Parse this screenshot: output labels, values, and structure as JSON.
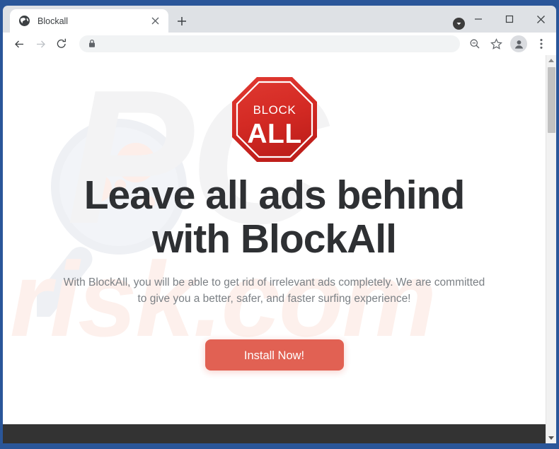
{
  "browser": {
    "frame_color": "#2a5699",
    "tab": {
      "title": "Blockall",
      "favicon_name": "globe-icon",
      "close_label": "×"
    },
    "new_tab_label": "+",
    "window_controls": {
      "minimize_label": "─",
      "maximize_label": "☐",
      "close_label": "×",
      "update_indicator_name": "update-chevron-icon"
    },
    "toolbar": {
      "back_label": "←",
      "forward_label": "→",
      "reload_label": "⟳",
      "omnibox_value": "",
      "omnibox_placeholder": "",
      "lock_icon_name": "lock-icon",
      "zoom_out_icon_name": "search-minus-icon",
      "bookmark_icon_name": "star-icon",
      "profile_icon_name": "person-icon",
      "menu_icon_name": "three-dot-menu-icon"
    }
  },
  "page": {
    "logo": {
      "top_text": "BLOCK",
      "main_text": "ALL",
      "shape": "octagon",
      "color": "#d32b25"
    },
    "headline_line1": "Leave all ads behind",
    "headline_line2": "with BlockAll",
    "headline_color": "#2e3033",
    "subheadline": "With BlockAll, you will be able to get rid of irrelevant ads completely. We are committed to give you a better, safer, and faster surfing experience!",
    "subheadline_color": "#7b8085",
    "cta_label": "Install Now!",
    "cta_color": "#e0594a",
    "footer_color": "#333333",
    "watermark": {
      "text_primary": "PC",
      "text_secondary": "risk.com",
      "primary_color": "#f3f3f4",
      "secondary_color": "#fdf0ec",
      "magnifier_icon_name": "magnifier-germs-icon"
    }
  },
  "scrollbar": {
    "up_arrow_name": "scroll-up-arrow",
    "down_arrow_name": "scroll-down-arrow",
    "thumb_name": "scroll-thumb"
  }
}
